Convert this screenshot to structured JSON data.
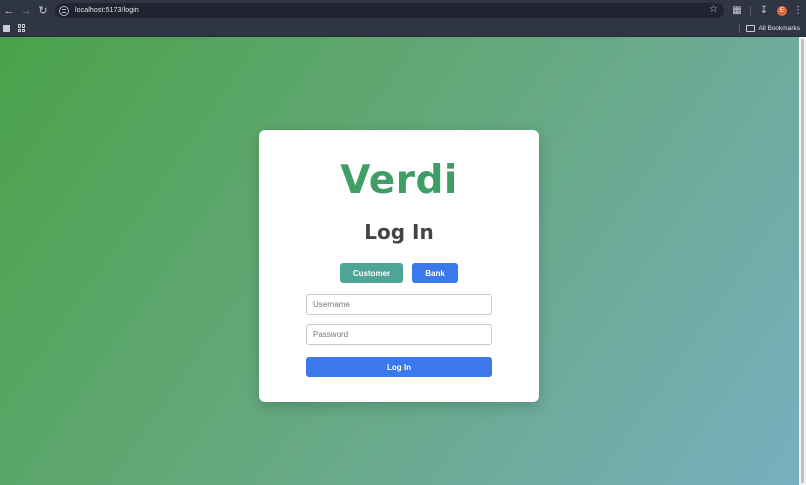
{
  "browser": {
    "url": "localhost:5173/login",
    "profile_initial": "E",
    "bookmarks_label": "All Bookmarks"
  },
  "login": {
    "brand": "Verdi",
    "heading": "Log In",
    "roles": {
      "customer": "Customer",
      "bank": "Bank"
    },
    "username_placeholder": "Username",
    "password_placeholder": "Password",
    "submit_label": "Log In"
  },
  "colors": {
    "brand": "#3e9e66",
    "customer_button": "#4fa597",
    "primary_button": "#3a78ec"
  }
}
